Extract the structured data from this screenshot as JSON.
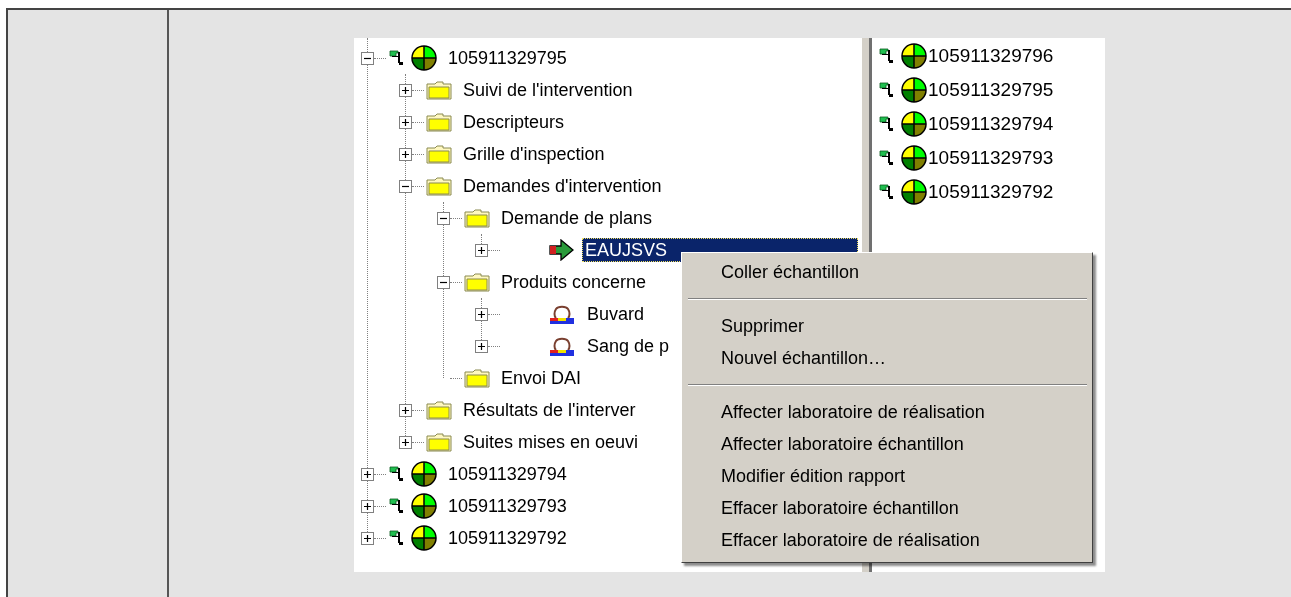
{
  "tree": {
    "nodes": [
      {
        "label": "105911329795",
        "kind": "record",
        "expandable": true,
        "expanded": true,
        "selected": false,
        "children": [
          {
            "label": "Suivi de l'intervention",
            "kind": "folder",
            "expandable": true,
            "expanded": false,
            "selected": false
          },
          {
            "label": "Descripteurs",
            "kind": "folder",
            "expandable": true,
            "expanded": false,
            "selected": false
          },
          {
            "label": "Grille d'inspection",
            "kind": "folder",
            "expandable": true,
            "expanded": false,
            "selected": false
          },
          {
            "label": "Demandes d'intervention",
            "kind": "folder",
            "expandable": true,
            "expanded": true,
            "selected": false,
            "children": [
              {
                "label": "Demande de plans",
                "kind": "folder",
                "expandable": true,
                "expanded": true,
                "selected": false,
                "children": [
                  {
                    "label": "EAUJSVS",
                    "kind": "request",
                    "expandable": true,
                    "expanded": false,
                    "selected": true
                  }
                ]
              },
              {
                "label": "Produits concerne",
                "kind": "folder",
                "expandable": true,
                "expanded": true,
                "selected": false,
                "children": [
                  {
                    "label": "Buvard",
                    "kind": "sample",
                    "expandable": true,
                    "expanded": false,
                    "selected": false
                  },
                  {
                    "label": "Sang de p",
                    "kind": "sample",
                    "expandable": true,
                    "expanded": false,
                    "selected": false
                  }
                ]
              },
              {
                "label": "Envoi DAI",
                "kind": "folder",
                "expandable": false,
                "expanded": false,
                "selected": false
              }
            ]
          },
          {
            "label": "Résultats de l'interver",
            "kind": "folder",
            "expandable": true,
            "expanded": false,
            "selected": false
          },
          {
            "label": "Suites mises en oeuvi",
            "kind": "folder",
            "expandable": true,
            "expanded": false,
            "selected": false
          }
        ]
      },
      {
        "label": "105911329794",
        "kind": "record",
        "expandable": true,
        "expanded": false,
        "selected": false
      },
      {
        "label": "105911329793",
        "kind": "record",
        "expandable": true,
        "expanded": false,
        "selected": false
      },
      {
        "label": "105911329792",
        "kind": "record",
        "expandable": true,
        "expanded": false,
        "selected": false
      }
    ]
  },
  "list": {
    "items": [
      {
        "label": "105911329796"
      },
      {
        "label": "105911329795"
      },
      {
        "label": "105911329794"
      },
      {
        "label": "105911329793"
      },
      {
        "label": "105911329792"
      }
    ]
  },
  "context_menu": {
    "items": [
      {
        "kind": "item",
        "label": "Coller échantillon"
      },
      {
        "kind": "separator"
      },
      {
        "kind": "item",
        "label": "Supprimer"
      },
      {
        "kind": "item",
        "label": "Nouvel échantillon…"
      },
      {
        "kind": "separator"
      },
      {
        "kind": "item",
        "label": "Affecter laboratoire de réalisation"
      },
      {
        "kind": "item",
        "label": "Affecter laboratoire échantillon"
      },
      {
        "kind": "item",
        "label": "Modifier édition rapport"
      },
      {
        "kind": "item",
        "label": "Effacer laboratoire échantillon"
      },
      {
        "kind": "item",
        "label": "Effacer laboratoire de réalisation"
      }
    ]
  }
}
